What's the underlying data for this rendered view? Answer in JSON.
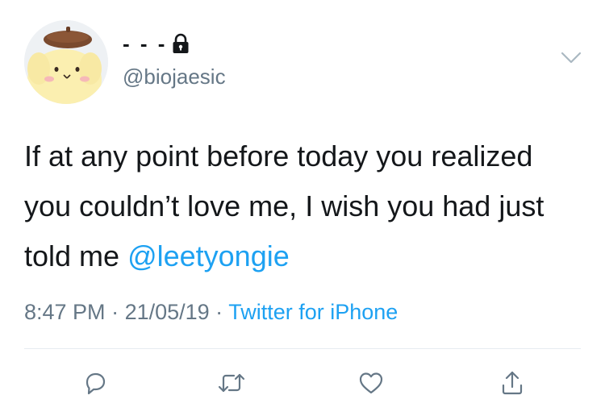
{
  "user": {
    "display_name": "- - -",
    "handle": "@biojaesic",
    "protected": true
  },
  "tweet": {
    "text": "If at any point before today you realized you couldn’t love me, I wish you had just told me ",
    "mention": "@leetyongie"
  },
  "meta": {
    "time": "8:47 PM",
    "separator": " · ",
    "date": "21/05/19",
    "source": "Twitter for iPhone"
  },
  "colors": {
    "text": "#14171a",
    "secondary": "#657786",
    "link": "#1da1f2",
    "divider": "#e6ecf0"
  },
  "icons": {
    "lock": "lock-icon",
    "caret": "chevron-down-icon",
    "reply": "reply-icon",
    "retweet": "retweet-icon",
    "like": "heart-icon",
    "share": "share-icon"
  }
}
